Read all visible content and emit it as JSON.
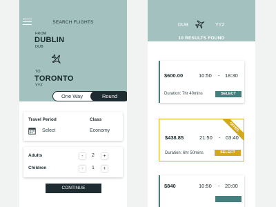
{
  "search": {
    "title": "SEARCH FLIGHTS",
    "from_label": "FROM",
    "from_city": "DUBLIN",
    "from_code": "DUB",
    "to_label": "TO",
    "to_city": "TORONTO",
    "to_code": "YYZ",
    "trip_types": [
      "One Way",
      "Round"
    ],
    "selected_trip_type": "Round",
    "travel_period_label": "Travel Period",
    "travel_period_value": "Select",
    "class_label": "Class",
    "class_value": "Economy",
    "adults_label": "Adults",
    "adults_value": "2",
    "children_label": "Children",
    "children_value": "1",
    "minus": "-",
    "plus": "+",
    "continue_label": "CONTINUE"
  },
  "results": {
    "from_code": "DUB",
    "to_code": "YYZ",
    "count_label": "10 RESULTS FOUND",
    "flights": [
      {
        "price": "$600.00",
        "depart": "10:50",
        "sep": "-",
        "arrive": "18:30",
        "duration": "Duration: 7hr 40mins",
        "select_label": "SELECT",
        "offer": false
      },
      {
        "price": "$438.85",
        "depart": "21:50",
        "sep": "-",
        "arrive": "03:40",
        "duration": "Duration: 6hr 50mins",
        "select_label": "SELECT",
        "offer": true,
        "offer_label": "OFFER"
      },
      {
        "price": "$840",
        "depart": "10:50",
        "sep": "-",
        "arrive": "20:00",
        "offer": false
      }
    ]
  },
  "colors": {
    "header_teal": "#a3c1be",
    "accent_teal": "#447f7e",
    "offer_gold": "#d1a81e",
    "dark": "#1e2b31"
  },
  "icons": [
    "menu-icon",
    "plane-icon",
    "calendar-icon"
  ]
}
